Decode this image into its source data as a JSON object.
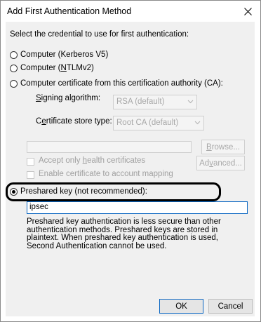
{
  "window": {
    "title": "Add First Authentication Method",
    "close_glyph": "✕"
  },
  "instruction": "Select the credential to use for first authentication:",
  "options": {
    "kerberos": "Computer (Kerberos V5)",
    "ntlm_prefix": "Computer (",
    "ntlm_ul": "N",
    "ntlm_suffix": "TLMv2)",
    "certificate": "Computer certificate from this certification authority (CA):",
    "preshared": "Preshared key (not recommended):"
  },
  "selected_option": "preshared",
  "certificate": {
    "signing_ul": "S",
    "signing_rest": "igning algorithm:",
    "signing_value": "RSA (default)",
    "store_pre": "C",
    "store_ul": "e",
    "store_rest": "rtificate store type:",
    "store_value": "Root CA (default)",
    "browse_ul": "B",
    "browse_rest": "rowse...",
    "accept_pre": "Accept only ",
    "accept_ul": "h",
    "accept_rest": "ealth certificates",
    "mapping": "Enable certificate to account mapping",
    "advanced_pre": "Ad",
    "advanced_ul": "v",
    "advanced_rest": "anced..."
  },
  "preshared_key": {
    "value": "ipsec"
  },
  "description": "Preshared key authentication is less secure than other authentication methods. Preshared keys are stored in plaintext. When preshared key authentication is used, Second Authentication cannot be used.",
  "buttons": {
    "ok": "OK",
    "cancel": "Cancel"
  },
  "colors": {
    "focus_border": "#0a66c2",
    "disabled_text": "#a0a0a0",
    "dialog_bg": "#f0f0f0"
  }
}
